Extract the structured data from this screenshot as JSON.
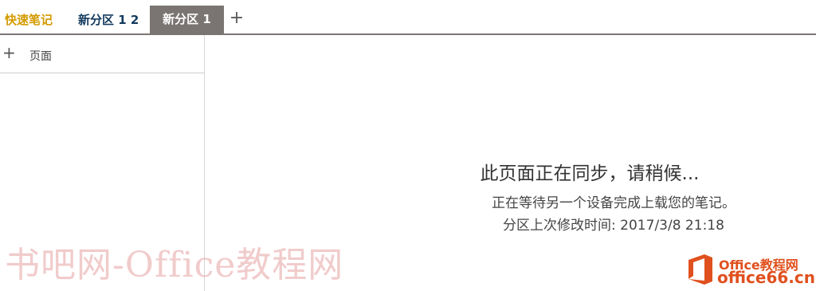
{
  "tabs": [
    {
      "label": "快速笔记",
      "color": "#d39b00"
    },
    {
      "label": "新分区 1 2",
      "color": "#123a5e"
    },
    {
      "label": "新分区 1",
      "active": true,
      "color": "#7a7573"
    }
  ],
  "tab_add_icon": "plus-icon",
  "pages_pane": {
    "add_page_label": "页面",
    "add_icon": "plus-icon"
  },
  "sync": {
    "title": "此页面正在同步，请稍候...",
    "message": "正在等待另一个设备完成上载您的笔记。",
    "last_modified": "分区上次修改时间: 2017/3/8 21:18"
  },
  "watermark": {
    "text": "书吧网-Office教程网",
    "logo_line1": "Office教程网",
    "logo_line2": "office66.cn"
  }
}
